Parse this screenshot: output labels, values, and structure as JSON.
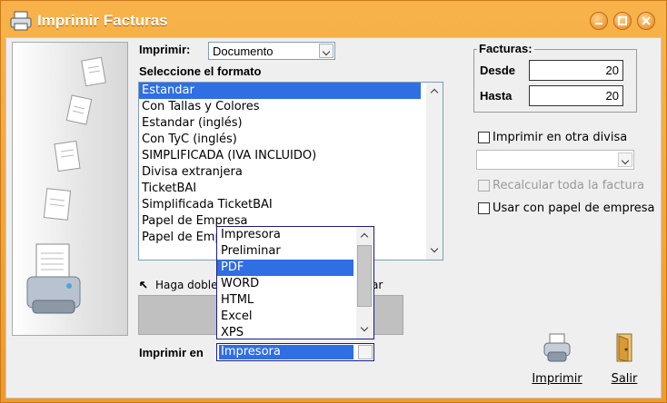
{
  "window": {
    "title": "Imprimir Facturas"
  },
  "imprimir": {
    "label": "Imprimir:",
    "value": "Documento"
  },
  "formato": {
    "label": "Seleccione el formato",
    "items": [
      "Estandar",
      "Con Tallas y Colores",
      "Estandar (inglés)",
      "Con TyC (inglés)",
      "SIMPLIFICADA (IVA INCLUIDO)",
      "Divisa extranjera",
      "TicketBAI",
      "Simplificada TicketBAI",
      "Papel de Empresa",
      "Papel de Emp"
    ],
    "selected": "Estandar"
  },
  "hint": {
    "left": "Haga doble",
    "right": "ar"
  },
  "facturas": {
    "title": "Facturas:",
    "desde_label": "Desde",
    "desde_value": "20",
    "hasta_label": "Hasta",
    "hasta_value": "20"
  },
  "options": {
    "otra_divisa": "Imprimir en otra divisa",
    "recalcular": "Recalcular toda la factura",
    "papel_empresa": "Usar con papel de empresa"
  },
  "imprimir_en": {
    "label": "Imprimir en",
    "value": "Impresora",
    "options": [
      "Impresora",
      "Preliminar",
      "PDF",
      "WORD",
      "HTML",
      "Excel",
      "XPS"
    ],
    "highlighted": "PDF"
  },
  "buttons": {
    "imprimir": "Imprimir",
    "salir": "Salir"
  }
}
